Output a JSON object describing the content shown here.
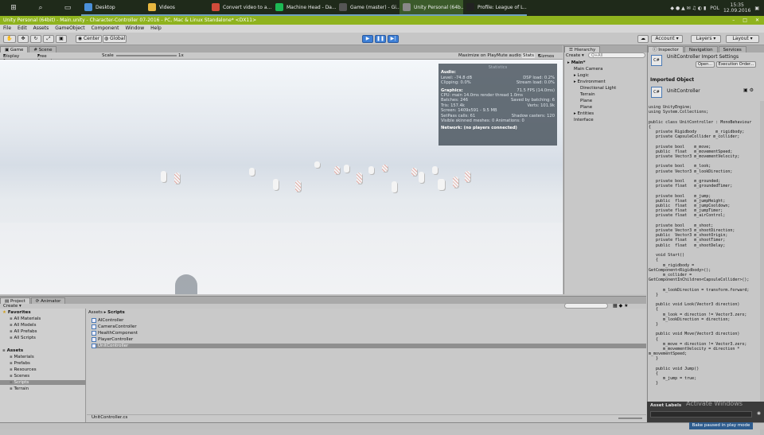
{
  "taskbar": {
    "tasks": [
      {
        "label": "Desktop",
        "color": "#4a90d9"
      },
      {
        "label": "Videos",
        "color": "#e8b840"
      },
      {
        "label": "Convert video to a...",
        "color": "#d04b3a"
      },
      {
        "label": "Machine Head - Da...",
        "color": "#1db954"
      },
      {
        "label": "Game (master) - Gi...",
        "color": "#555"
      },
      {
        "label": "Unity Personal (64b...",
        "color": "#888"
      },
      {
        "label": "Profile: League of L...",
        "color": "#222"
      }
    ],
    "lang": "POL",
    "time": "15:35",
    "date": "12.09.2016"
  },
  "window": {
    "title": "Unity Personal (64bit) - Main.unity - Character-Controller 07-2016 - PC, Mac & Linux Standalone* <DX11>"
  },
  "menu": [
    "File",
    "Edit",
    "Assets",
    "GameObject",
    "Component",
    "Window",
    "Help"
  ],
  "toolbar": {
    "center": "Center",
    "global": "Global",
    "account": "Account",
    "layers": "Layers",
    "layout": "Layout"
  },
  "game": {
    "tab_game": "Game",
    "tab_scene": "Scene",
    "display": "Display 1",
    "aspect": "Free Aspect",
    "scale_label": "Scale",
    "scale_value": "1x",
    "maximize": "Maximize on Play",
    "mute": "Mute audio",
    "stats": "Stats",
    "gizmos": "Gizmos"
  },
  "statistics": {
    "title": "Statistics",
    "audio_header": "Audio:",
    "level": "Level: -74.8 dB",
    "clipping": "Clipping: 0.0%",
    "dsp": "DSP load: 0.2%",
    "stream": "Stream load: 0.0%",
    "graphics_header": "Graphics:",
    "fps": "71.5 FPS (14.0ms)",
    "cpu": "CPU: main 14.0ms  render thread 1.0ms",
    "batches": "Batches: 246",
    "saved": "Saved by batching: 6",
    "tris": "Tris: 157.4k",
    "verts": "Verts: 101.9k",
    "screen": "Screen: 1409x591 - 9.5 MB",
    "setpass": "SetPass calls: 61",
    "shadow": "Shadow casters: 120",
    "skinned": "Visible skinned meshes: 0   Animations: 0",
    "network": "Network: (no players connected)"
  },
  "hierarchy": {
    "tab": "Hierarchy",
    "create": "Create",
    "search": "Q+All",
    "items": [
      {
        "label": "Main*",
        "indent": 0
      },
      {
        "label": "Main Camera",
        "indent": 1
      },
      {
        "label": "Logic",
        "indent": 1
      },
      {
        "label": "Environment",
        "indent": 1
      },
      {
        "label": "Directional Light",
        "indent": 2
      },
      {
        "label": "Terrain",
        "indent": 2
      },
      {
        "label": "Plane",
        "indent": 2
      },
      {
        "label": "Plane",
        "indent": 2
      },
      {
        "label": "Entities",
        "indent": 1
      },
      {
        "label": "Interface",
        "indent": 1
      }
    ]
  },
  "inspector": {
    "tab_inspector": "Inspector",
    "tab_navigation": "Navigation",
    "tab_services": "Services",
    "import_title": "UnitController Import Settings",
    "open": "Open...",
    "exec_order": "Execution Order...",
    "imported_object": "Imported Object",
    "object_name": "UnitController",
    "code": "using UnityEngine;\nusing System.Collections;\n\npublic class UnitController : MonoBehaviour\n{\n   private Rigidbody        m_rigidbody;\n   private CapsuleCollider m_collider;\n\n   private bool    m_move;\n   public  float   m_movementSpeed;\n   private Vector3 m_movementVelocity;\n\n   private bool    m_look;\n   private Vector3 m_lookDirection;\n\n   private bool    m_grounded;\n   private float   m_groundedTimer;\n\n   private bool    m_jump;\n   public  float   m_jumpHeight;\n   public  float   m_jumpCooldown;\n   private float   m_jumpTimer;\n   private float   m_airControl;\n\n   private bool    m_shoot;\n   private Vector3 m_shootDirection;\n   public  Vector3 m_shootOrigin;\n   private float   m_shootTimer;\n   public  float   m_shootDelay;\n\n   void Start()\n   {\n      m_rigidbody =\nGetComponent<Rigidbody>();\n      m_collider =\nGetComponentInChildren<CapsuleCollider>();\n\n      m_lookDirection = transform.forward;\n   }\n\n   public void Look(Vector3 direction)\n   {\n      m_look = direction != Vector3.zero;\n      m_lookDirection = direction;\n   }\n\n   public void Move(Vector3 direction)\n   {\n      m_move = direction != Vector3.zero;\n      m_movementVelocity = direction *\nm_movementSpeed;\n   }\n\n   public void Jump()\n   {\n      m_jump = true;\n   }",
    "asset_labels": "Asset Labels",
    "watermark": "Activate Windows"
  },
  "project": {
    "tab_project": "Project",
    "tab_animator": "Animator",
    "create": "Create",
    "breadcrumb_assets": "Assets",
    "breadcrumb_scripts": "Scripts",
    "tree": [
      {
        "label": "Favorites",
        "indent": 0,
        "bold": true
      },
      {
        "label": "All Materials",
        "indent": 1
      },
      {
        "label": "All Models",
        "indent": 1
      },
      {
        "label": "All Prefabs",
        "indent": 1
      },
      {
        "label": "All Scripts",
        "indent": 1
      },
      {
        "label": "",
        "indent": 0
      },
      {
        "label": "Assets",
        "indent": 0,
        "bold": true
      },
      {
        "label": "Materials",
        "indent": 1
      },
      {
        "label": "Prefabs",
        "indent": 1
      },
      {
        "label": "Resources",
        "indent": 1
      },
      {
        "label": "Scenes",
        "indent": 1
      },
      {
        "label": "Scripts",
        "indent": 1,
        "selected": true
      },
      {
        "label": "Terrain",
        "indent": 1
      }
    ],
    "files": [
      "AIController",
      "CameraController",
      "HealthComponent",
      "PlayerController",
      "UnitController"
    ],
    "selected_file": "UnitController",
    "status_file": "UnitController.cs"
  },
  "status": {
    "paused": "Bake paused in play mode"
  }
}
